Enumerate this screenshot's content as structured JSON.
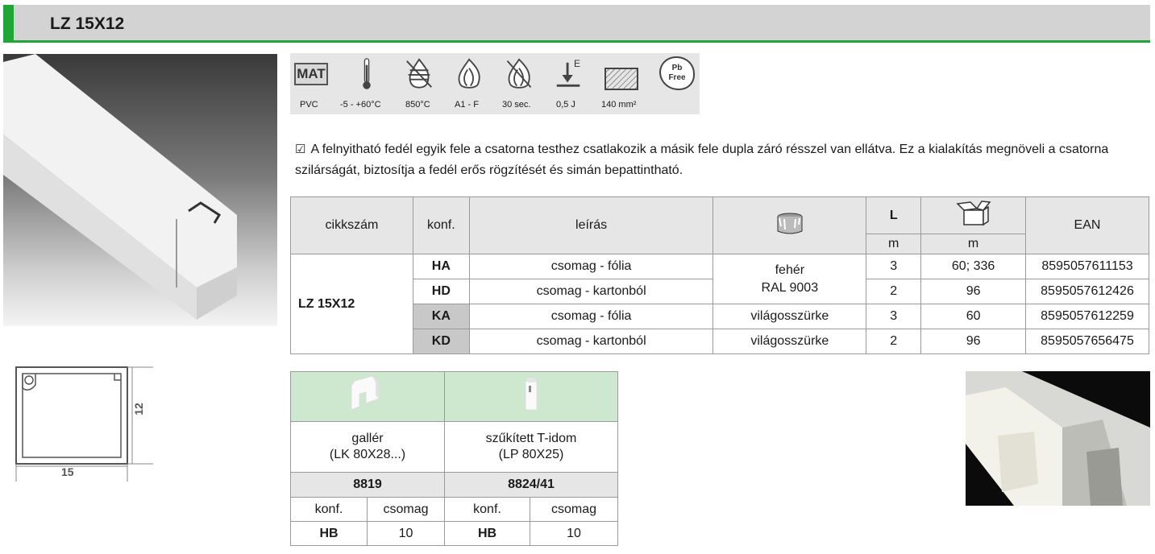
{
  "header": {
    "title": "LZ 15X12"
  },
  "icons": [
    {
      "icon": "mat-icon",
      "glyph": "MAT",
      "label": "PVC"
    },
    {
      "icon": "thermometer-icon",
      "label": "-5 - +60°C"
    },
    {
      "icon": "glow-wire-icon",
      "label": "850°C"
    },
    {
      "icon": "flame-icon",
      "label": "A1 - F"
    },
    {
      "icon": "fire-resistance-icon",
      "label": "30 sec."
    },
    {
      "icon": "impact-icon",
      "glyph": "E",
      "label": "0,5 J"
    },
    {
      "icon": "cross-section-icon",
      "label": "140 mm²"
    },
    {
      "icon": "pb-free-icon",
      "glyph_line1": "Pb",
      "glyph_line2": "Free"
    }
  ],
  "description": "A felnyitható fedél egyik fele a csatorna testhez csatlakozik a másik fele dupla záró résszel van ellátva. Ez a kialakítás megnöveli a csatorna szilárságát, biztosítja a fedél erős rögzítését és simán bepattintható.",
  "table": {
    "headers": {
      "cikkszam": "cikkszám",
      "konf": "konf.",
      "leiras": "leírás",
      "length": "L",
      "length_unit": "m",
      "box_unit": "m",
      "ean": "EAN"
    },
    "article": "LZ 15X12",
    "color_white_line1": "fehér",
    "color_white_line2": "RAL 9003",
    "rows": [
      {
        "konf": "HA",
        "leiras": "csomag - fólia",
        "szin": "",
        "l": "3",
        "box": "60; 336",
        "ean": "8595057611153"
      },
      {
        "konf": "HD",
        "leiras": "csomag - kartonból",
        "szin": "",
        "l": "2",
        "box": "96",
        "ean": "8595057612426"
      },
      {
        "konf": "KA",
        "leiras": "csomag - fólia",
        "szin": "világosszürke",
        "l": "3",
        "box": "60",
        "ean": "8595057612259"
      },
      {
        "konf": "KD",
        "leiras": "csomag - kartonból",
        "szin": "világosszürke",
        "l": "2",
        "box": "96",
        "ean": "8595057656475"
      }
    ]
  },
  "accessories": [
    {
      "name_line1": "gallér",
      "name_line2": "(LK 80X28...)",
      "code": "8819",
      "konf_header": "konf.",
      "csomag_header": "csomag",
      "konf": "HB",
      "csomag": "10"
    },
    {
      "name_line1": "szűkített T-idom",
      "name_line2": "(LP 80X25)",
      "code": "8824/41",
      "konf_header": "konf.",
      "csomag_header": "csomag",
      "konf": "HB",
      "csomag": "10"
    }
  ],
  "cross_section": {
    "width": "15",
    "height": "12"
  }
}
